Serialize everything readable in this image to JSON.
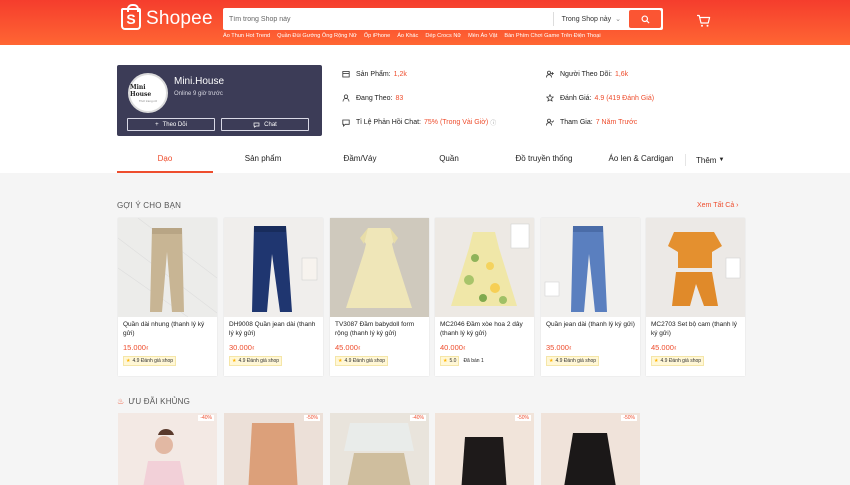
{
  "header": {
    "logo_text": "Shopee",
    "search_placeholder": "Tìm trong Shop này",
    "search_scope": "Trong Shop này",
    "hot_keywords": [
      "Áo Thun Hot Trend",
      "Quần Đùi Gướng Ông Rộng Nữ",
      "Ốp iPhone",
      "Áo Khác",
      "Dép Crocs Nữ",
      "Mèn Áo Vật",
      "Bàn Phím Chơi Game Trên Điện Thoại"
    ]
  },
  "shop": {
    "avatar_text": "Mini House",
    "avatar_sub": "Thời trang nữ",
    "name": "Mini.House",
    "online": "Online 9 giờ trước",
    "follow_label": "Theo Dõi",
    "chat_label": "Chat",
    "stats": {
      "products_label": "Sản Phẩm:",
      "products_value": "1,2k",
      "following_label": "Đang Theo:",
      "following_value": "83",
      "chat_label": "Tỉ Lệ Phản Hồi Chat:",
      "chat_value": "75% (Trong Vài Giờ)",
      "followers_label": "Người Theo Dõi:",
      "followers_value": "1,6k",
      "rating_label": "Đánh Giá:",
      "rating_value": "4.9 (419 Đánh Giá)",
      "joined_label": "Tham Gia:",
      "joined_value": "7 Năm Trước"
    }
  },
  "tabs": [
    "Dạo",
    "Sản phẩm",
    "Đầm/Váy",
    "Quần",
    "Đồ truyền thống",
    "Áo len & Cardigan"
  ],
  "tab_more": "Thêm",
  "recommend": {
    "title": "GỢI Ý CHO BẠN",
    "see_all": "Xem Tất Cả",
    "items": [
      {
        "name": "Quần dài nhung (thanh lý ký gửi)",
        "price": "15.000",
        "currency": "₫",
        "rating": "4.9 Đánh giá shop",
        "extra": ""
      },
      {
        "name": "DH9008 Quần jean dài (thanh lý ký gửi)",
        "price": "30.000",
        "currency": "₫",
        "rating": "4.9 Đánh giá shop",
        "extra": ""
      },
      {
        "name": "TV3087 Đầm babydoll form rộng (thanh lý ký gửi)",
        "price": "45.000",
        "currency": "₫",
        "rating": "4.9 Đánh giá shop",
        "extra": ""
      },
      {
        "name": "MC2046 Đầm xòe hoa 2 dây (thanh lý ký gửi)",
        "price": "40.000",
        "currency": "₫",
        "rating": "5.0",
        "extra": "Đã bán 1"
      },
      {
        "name": "Quần jean dài (thanh lý ký gửi)",
        "price": "35.000",
        "currency": "₫",
        "rating": "4.9 Đánh giá shop",
        "extra": ""
      },
      {
        "name": "MC2703 Set bộ cam (thanh lý ký gửi)",
        "price": "45.000",
        "currency": "₫",
        "rating": "4.9 Đánh giá shop",
        "extra": ""
      }
    ]
  },
  "deals": {
    "title": "ƯU ĐÃI KHỦNG",
    "discounts": [
      "-40%",
      "-50%",
      "-40%",
      "-50%",
      "-50%"
    ]
  },
  "colors": {
    "brand": "#ee4d2d",
    "shop_card": "#3c3c57"
  }
}
